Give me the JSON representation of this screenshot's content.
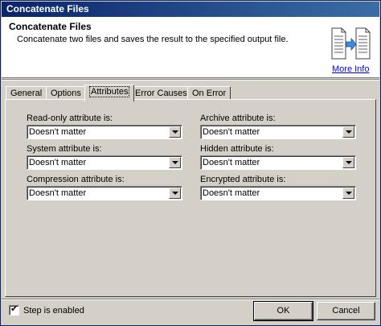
{
  "window": {
    "title": "Concatenate Files"
  },
  "header": {
    "title": "Concatenate Files",
    "description": "Concatenate two files and saves the result to the specified output file.",
    "more_info": "More Info"
  },
  "tabs": [
    {
      "label": "General",
      "active": false
    },
    {
      "label": "Options",
      "active": false
    },
    {
      "label": "Attributes",
      "active": true
    },
    {
      "label": "Error Causes",
      "active": false
    },
    {
      "label": "On Error",
      "active": false
    }
  ],
  "attributes": {
    "readonly": {
      "label": "Read-only attribute is:",
      "value": "Doesn't matter"
    },
    "archive": {
      "label": "Archive attribute is:",
      "value": "Doesn't matter"
    },
    "system": {
      "label": "System attribute is:",
      "value": "Doesn't matter"
    },
    "hidden": {
      "label": "Hidden attribute is:",
      "value": "Doesn't matter"
    },
    "compression": {
      "label": "Compression attribute is:",
      "value": "Doesn't matter"
    },
    "encrypted": {
      "label": "Encrypted attribute is:",
      "value": "Doesn't matter"
    }
  },
  "footer": {
    "step_enabled_label": "Step is enabled",
    "step_enabled_checked": true,
    "checkmark": "✔",
    "ok_label": "OK",
    "cancel_label": "Cancel"
  },
  "icons": {
    "header_icon": "concatenate-files-icon",
    "combo_arrow": "chevron-down-icon"
  }
}
